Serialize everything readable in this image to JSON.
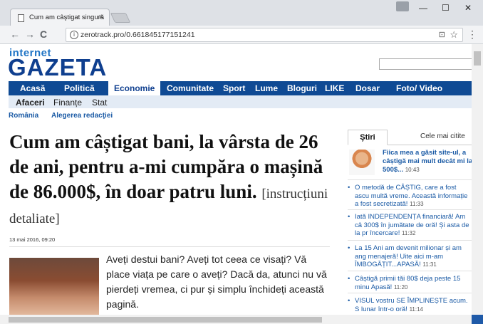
{
  "browser": {
    "tab_title": "Cum am câştigat singură",
    "tab_close": "×",
    "url": "zerotrack.pro/0.661845177151241",
    "win_min": "—",
    "win_max": "☐",
    "win_close": "✕",
    "back": "←",
    "forward": "→",
    "reload": "C",
    "info": "i",
    "translate": "⊡",
    "star": "☆",
    "menu": "⋮"
  },
  "site": {
    "logo_top": "internet",
    "logo_main": "GAZETA",
    "nav": [
      "Acasă",
      "Politică",
      "Economie",
      "Comunitate",
      "Sport",
      "Lume",
      "Bloguri",
      "LIKE",
      "Dosar",
      "Foto/ Video"
    ],
    "subnav": [
      "Afaceri",
      "Finanțe",
      "Stat"
    ],
    "crumbs": [
      "România",
      "Alegerea redacţiei"
    ]
  },
  "article": {
    "title": "Cum am câștigat bani, la vârsta de 26 de ani, pentru a-mi cumpăra o mașină de 86.000$, în doar patru luni.",
    "subtitle": "[instrucțiuni detaliate]",
    "date": "13 mai 2016, 09:20",
    "body": "Aveți destui bani? Aveți tot ceea ce visați? Vă place viața pe care o aveți? Dacă da, atunci nu vă pierdeți vremea, ci pur și simplu închideți această pagină."
  },
  "sidebar": {
    "tab_news": "Ştiri",
    "tab_popular": "Cele mai citite",
    "featured": {
      "text": "Fiica mea a găsit site-ul, a câștigă mai mult decât mi la 500$...",
      "time": "10:43"
    },
    "items": [
      {
        "text": "O metodă de CÂȘTIG, care a fost ascu multă vreme. Această informație a fost secretizată!",
        "time": "11:33"
      },
      {
        "text": "Iată INDEPENDENȚA financiară! Am câ 300$ în jumătate de oră! Și asta de la pr încercare!",
        "time": "11:32"
      },
      {
        "text": "La 15 Ani am devenit milionar și am ang menajeră! Uite aici m-am ÎMBOGĂȚIT...APASĂ!",
        "time": "11:31"
      },
      {
        "text": "Câștigă primii tăi 80$ deja peste 15 minu Apasă!",
        "time": "11:20"
      },
      {
        "text": "VISUL vostru SE ÎMPLINEȘTE acum. S lunar într-o oră!",
        "time": "11:14"
      }
    ]
  },
  "colors": {
    "brand": "#0f3f8f",
    "link": "#1a5aa5",
    "nav_bg": "#0f4a94"
  }
}
